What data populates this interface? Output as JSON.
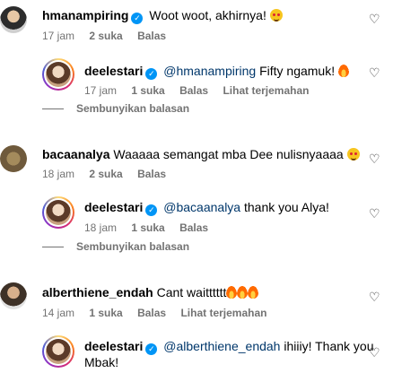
{
  "comments": [
    {
      "username": "hmanampiring",
      "text": "Woot woot, akhirnya!",
      "time": "17 jam",
      "likes": "2 suka",
      "reply": "Balas"
    },
    {
      "username": "deelestari",
      "mention": "@hmanampiring",
      "text": "Fifty ngamuk!",
      "time": "17 jam",
      "likes": "1 suka",
      "reply": "Balas",
      "translate": "Lihat terjemahan"
    },
    {
      "username": "bacaanalya",
      "text": "Waaaaa semangat mba Dee nulisnyaaaa",
      "time": "18 jam",
      "likes": "2 suka",
      "reply": "Balas"
    },
    {
      "username": "deelestari",
      "mention": "@bacaanalya",
      "text": "thank you Alya!",
      "time": "18 jam",
      "likes": "1 suka",
      "reply": "Balas"
    },
    {
      "username": "alberthiene_endah",
      "text": "Cant waitttttt",
      "time": "14 jam",
      "likes": "1 suka",
      "reply": "Balas",
      "translate": "Lihat terjemahan"
    },
    {
      "username": "deelestari",
      "mention": "@alberthiene_endah",
      "text": "ihiiiy! Thank you",
      "text2": "Mbak!"
    }
  ],
  "hide_replies_label": "Sembunyikan balasan",
  "icons": {
    "like": "heart-outline-icon",
    "verified": "verified-badge-icon",
    "emoji_fire": "fire-emoji",
    "emoji_smile": "heart-eyes-emoji"
  },
  "colors": {
    "verified": "#0095f6",
    "mention": "#00376b",
    "meta": "#737373"
  }
}
